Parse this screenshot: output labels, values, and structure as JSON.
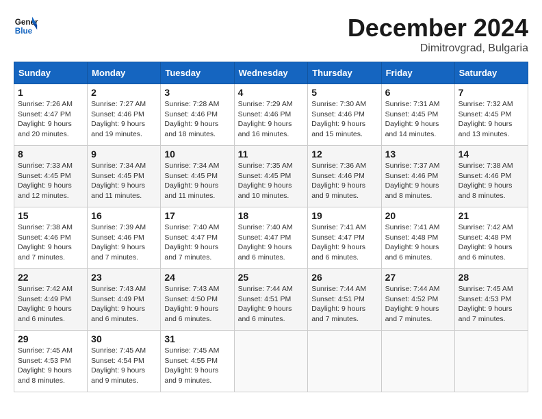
{
  "header": {
    "logo_line1": "General",
    "logo_line2": "Blue",
    "month_title": "December 2024",
    "location": "Dimitrovgrad, Bulgaria"
  },
  "weekdays": [
    "Sunday",
    "Monday",
    "Tuesday",
    "Wednesday",
    "Thursday",
    "Friday",
    "Saturday"
  ],
  "weeks": [
    [
      {
        "day": "1",
        "sunrise": "7:26 AM",
        "sunset": "4:47 PM",
        "daylight": "9 hours and 20 minutes."
      },
      {
        "day": "2",
        "sunrise": "7:27 AM",
        "sunset": "4:46 PM",
        "daylight": "9 hours and 19 minutes."
      },
      {
        "day": "3",
        "sunrise": "7:28 AM",
        "sunset": "4:46 PM",
        "daylight": "9 hours and 18 minutes."
      },
      {
        "day": "4",
        "sunrise": "7:29 AM",
        "sunset": "4:46 PM",
        "daylight": "9 hours and 16 minutes."
      },
      {
        "day": "5",
        "sunrise": "7:30 AM",
        "sunset": "4:46 PM",
        "daylight": "9 hours and 15 minutes."
      },
      {
        "day": "6",
        "sunrise": "7:31 AM",
        "sunset": "4:45 PM",
        "daylight": "9 hours and 14 minutes."
      },
      {
        "day": "7",
        "sunrise": "7:32 AM",
        "sunset": "4:45 PM",
        "daylight": "9 hours and 13 minutes."
      }
    ],
    [
      {
        "day": "8",
        "sunrise": "7:33 AM",
        "sunset": "4:45 PM",
        "daylight": "9 hours and 12 minutes."
      },
      {
        "day": "9",
        "sunrise": "7:34 AM",
        "sunset": "4:45 PM",
        "daylight": "9 hours and 11 minutes."
      },
      {
        "day": "10",
        "sunrise": "7:34 AM",
        "sunset": "4:45 PM",
        "daylight": "9 hours and 11 minutes."
      },
      {
        "day": "11",
        "sunrise": "7:35 AM",
        "sunset": "4:45 PM",
        "daylight": "9 hours and 10 minutes."
      },
      {
        "day": "12",
        "sunrise": "7:36 AM",
        "sunset": "4:46 PM",
        "daylight": "9 hours and 9 minutes."
      },
      {
        "day": "13",
        "sunrise": "7:37 AM",
        "sunset": "4:46 PM",
        "daylight": "9 hours and 8 minutes."
      },
      {
        "day": "14",
        "sunrise": "7:38 AM",
        "sunset": "4:46 PM",
        "daylight": "9 hours and 8 minutes."
      }
    ],
    [
      {
        "day": "15",
        "sunrise": "7:38 AM",
        "sunset": "4:46 PM",
        "daylight": "9 hours and 7 minutes."
      },
      {
        "day": "16",
        "sunrise": "7:39 AM",
        "sunset": "4:46 PM",
        "daylight": "9 hours and 7 minutes."
      },
      {
        "day": "17",
        "sunrise": "7:40 AM",
        "sunset": "4:47 PM",
        "daylight": "9 hours and 7 minutes."
      },
      {
        "day": "18",
        "sunrise": "7:40 AM",
        "sunset": "4:47 PM",
        "daylight": "9 hours and 6 minutes."
      },
      {
        "day": "19",
        "sunrise": "7:41 AM",
        "sunset": "4:47 PM",
        "daylight": "9 hours and 6 minutes."
      },
      {
        "day": "20",
        "sunrise": "7:41 AM",
        "sunset": "4:48 PM",
        "daylight": "9 hours and 6 minutes."
      },
      {
        "day": "21",
        "sunrise": "7:42 AM",
        "sunset": "4:48 PM",
        "daylight": "9 hours and 6 minutes."
      }
    ],
    [
      {
        "day": "22",
        "sunrise": "7:42 AM",
        "sunset": "4:49 PM",
        "daylight": "9 hours and 6 minutes."
      },
      {
        "day": "23",
        "sunrise": "7:43 AM",
        "sunset": "4:49 PM",
        "daylight": "9 hours and 6 minutes."
      },
      {
        "day": "24",
        "sunrise": "7:43 AM",
        "sunset": "4:50 PM",
        "daylight": "9 hours and 6 minutes."
      },
      {
        "day": "25",
        "sunrise": "7:44 AM",
        "sunset": "4:51 PM",
        "daylight": "9 hours and 6 minutes."
      },
      {
        "day": "26",
        "sunrise": "7:44 AM",
        "sunset": "4:51 PM",
        "daylight": "9 hours and 7 minutes."
      },
      {
        "day": "27",
        "sunrise": "7:44 AM",
        "sunset": "4:52 PM",
        "daylight": "9 hours and 7 minutes."
      },
      {
        "day": "28",
        "sunrise": "7:45 AM",
        "sunset": "4:53 PM",
        "daylight": "9 hours and 7 minutes."
      }
    ],
    [
      {
        "day": "29",
        "sunrise": "7:45 AM",
        "sunset": "4:53 PM",
        "daylight": "9 hours and 8 minutes."
      },
      {
        "day": "30",
        "sunrise": "7:45 AM",
        "sunset": "4:54 PM",
        "daylight": "9 hours and 9 minutes."
      },
      {
        "day": "31",
        "sunrise": "7:45 AM",
        "sunset": "4:55 PM",
        "daylight": "9 hours and 9 minutes."
      },
      null,
      null,
      null,
      null
    ]
  ],
  "labels": {
    "sunrise": "Sunrise:",
    "sunset": "Sunset:",
    "daylight": "Daylight:"
  }
}
